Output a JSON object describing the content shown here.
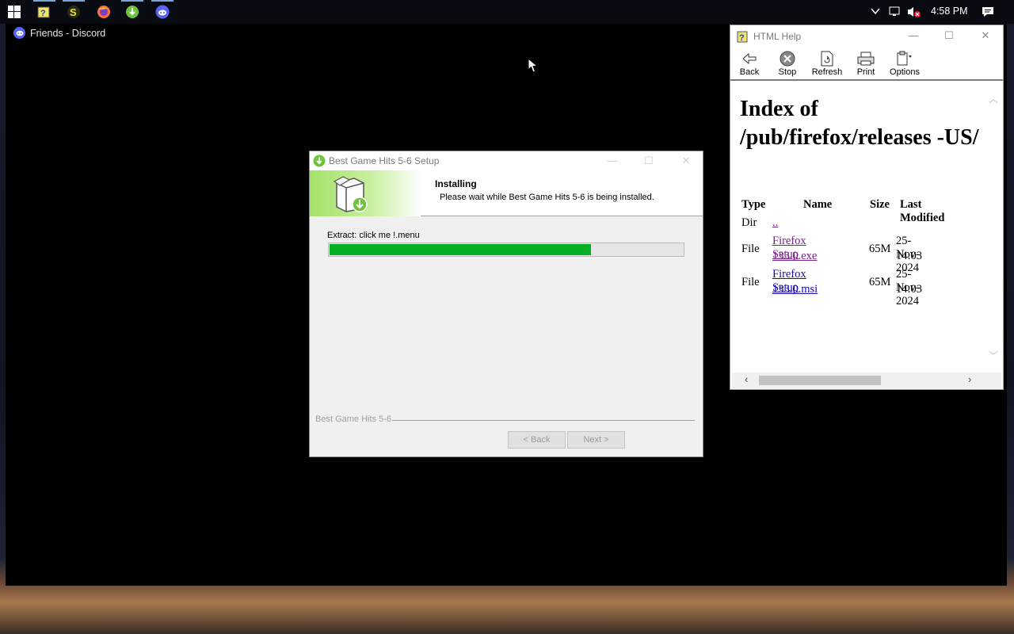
{
  "taskbar": {
    "pinned": [
      {
        "name": "windows-start-icon"
      },
      {
        "name": "html-help-app-icon"
      },
      {
        "name": "s-app-icon"
      },
      {
        "name": "firefox-icon"
      },
      {
        "name": "installer-app-icon"
      },
      {
        "name": "discord-icon"
      }
    ],
    "tray": {
      "time": "4:58 PM"
    }
  },
  "discord": {
    "title": "Friends - Discord"
  },
  "setup": {
    "window_title": "Best Game Hits 5-6 Setup",
    "heading": "Installing",
    "subheading": "Please wait while Best Game Hits 5-6 is being installed.",
    "status_text": "Extract: click me !.menu",
    "progress_fraction": 0.74,
    "brand_text": "Best Game Hits 5-6",
    "back_label": "< Back",
    "next_label": "Next >"
  },
  "help": {
    "window_title": "HTML Help",
    "toolbar": {
      "back": "Back",
      "stop": "Stop",
      "refresh": "Refresh",
      "print": "Print",
      "options": "Options"
    },
    "page_heading": "Index of /pub/firefox/releases -US/",
    "table": {
      "headers": [
        "Type",
        "Name",
        "Size",
        "Last Modified"
      ],
      "rows": [
        {
          "type": "Dir",
          "name": "..",
          "size": "",
          "modified": ""
        },
        {
          "type": "File",
          "name_line1": "Firefox Setup",
          "name_line2": "133.0.exe",
          "size": "65M",
          "modified_line1": "25-Nov-2024",
          "modified_line2": "14:03"
        },
        {
          "type": "File",
          "name_line1": "Firefox Setup",
          "name_line2": "133.0.msi",
          "size": "65M",
          "modified_line1": "25-Nov-2024",
          "modified_line2": "14:03"
        }
      ]
    }
  },
  "colors": {
    "progress": "#06b025",
    "discord": "#5865f2",
    "link": "#1a0dab",
    "visited_link": "#7a1f8d"
  }
}
